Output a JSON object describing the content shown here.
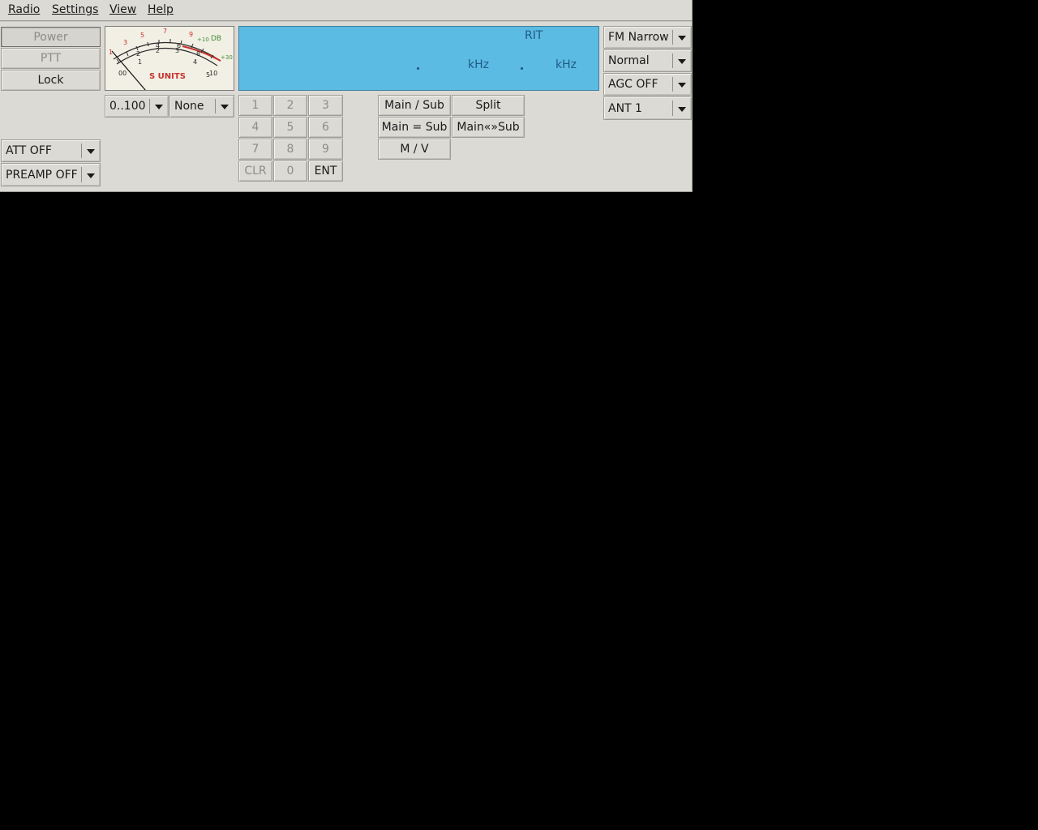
{
  "menu": [
    "Radio",
    "Settings",
    "View",
    "Help"
  ],
  "left_buttons": {
    "power": "Power",
    "ptt": "PTT",
    "lock": "Lock"
  },
  "att_select": "ATT OFF",
  "preamp_select": "PREAMP OFF",
  "meter": {
    "label": "S UNITS",
    "db_label": "DB",
    "scale_top": [
      "1",
      "3",
      "5",
      "7",
      "9",
      "+10",
      "+30"
    ],
    "scale_bottom": [
      "1",
      "2",
      "4",
      "6",
      "8",
      "10"
    ],
    "scale_inner": [
      "2",
      "2",
      "3",
      "4",
      "5"
    ],
    "scale_left": "00"
  },
  "meter_range_select": "0..100",
  "meter_mode_select": "None",
  "display": {
    "rit_label": "RIT",
    "unit_main": "kHz",
    "unit_sub": "kHz"
  },
  "keypad": [
    "1",
    "2",
    "3",
    "4",
    "5",
    "6",
    "7",
    "8",
    "9",
    "CLR",
    "0",
    "ENT"
  ],
  "vfo_buttons": {
    "main_sub": "Main / Sub",
    "split": "Split",
    "main_eq_sub": "Main = Sub",
    "main_swap_sub": "Main«»Sub",
    "m_v": "M / V"
  },
  "right_selects": {
    "mode": "FM Narrow",
    "filter": "Normal",
    "agc": "AGC OFF",
    "antenna": "ANT 1"
  },
  "colors": {
    "window_bg": "#dcdad5",
    "display_bg": "#5cbbe2",
    "display_text": "#1f5a86",
    "meter_red": "#c8322d",
    "meter_green": "#3f8f3a",
    "desktop": "#000000"
  }
}
